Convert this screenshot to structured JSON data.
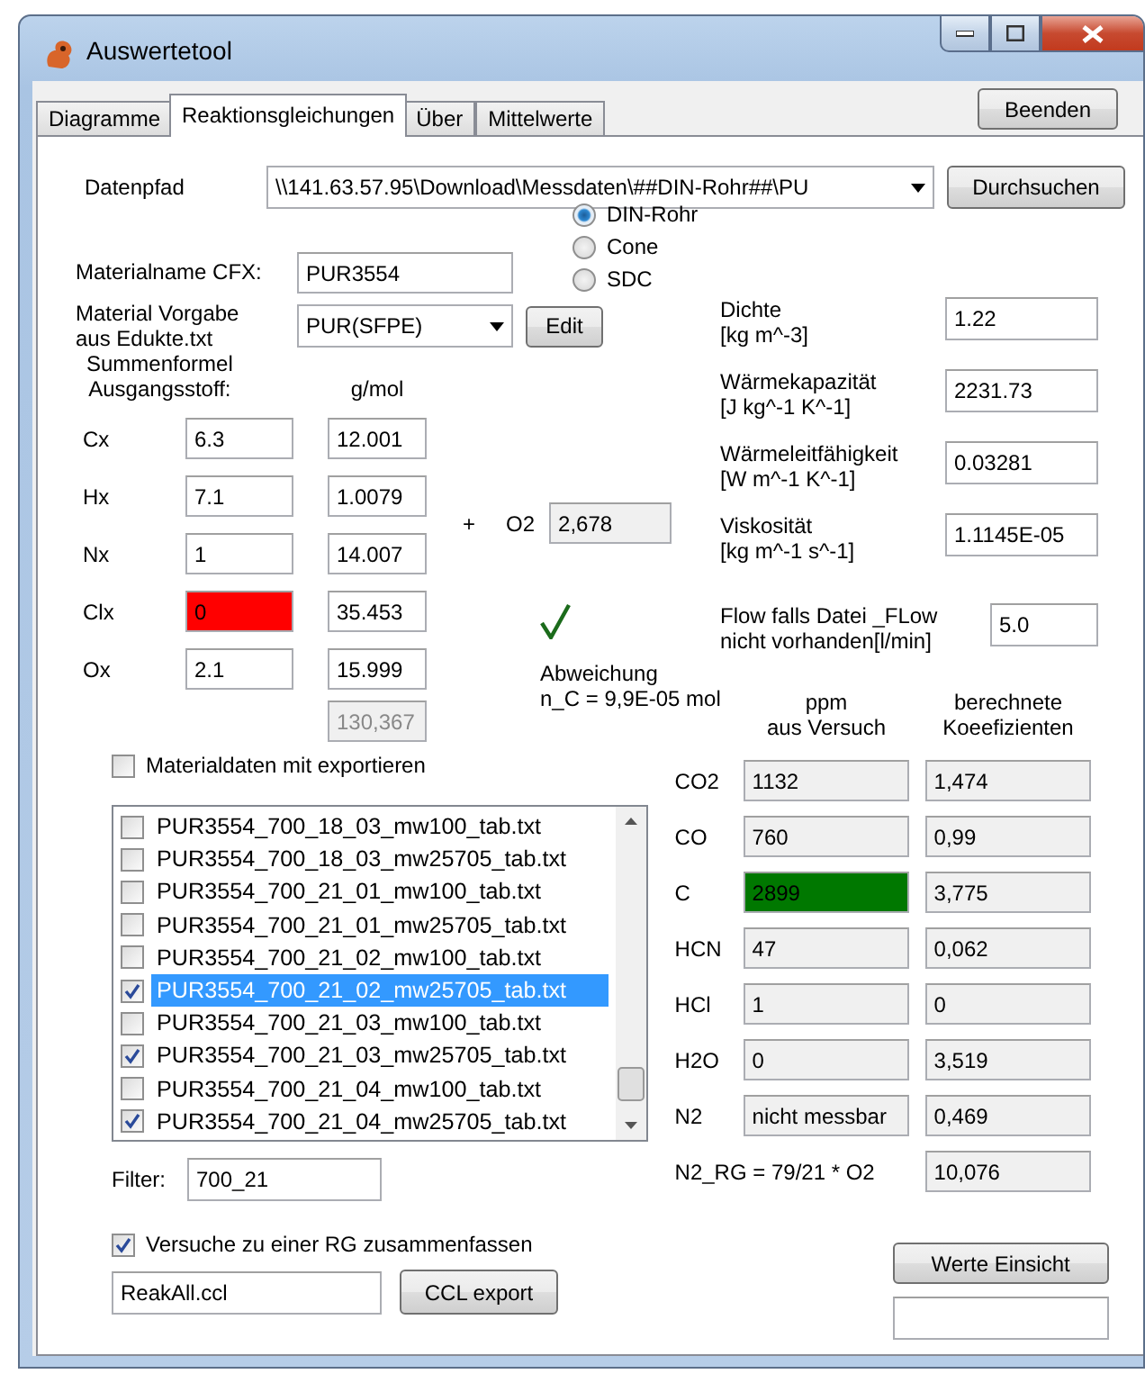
{
  "window": {
    "title": "Auswertetool"
  },
  "tabs": [
    {
      "label": "Diagramme",
      "selected": false
    },
    {
      "label": "Reaktionsgleichungen",
      "selected": true
    },
    {
      "label": "Über",
      "selected": false
    },
    {
      "label": "Mittelwerte",
      "selected": false
    }
  ],
  "quit_button": "Beenden",
  "data_path": {
    "label": "Datenpfad",
    "value": "\\\\141.63.57.95\\Download\\Messdaten\\##DIN-Rohr##\\PU",
    "button": "Durchsuchen"
  },
  "source_options": [
    {
      "label": "DIN-Rohr",
      "selected": true
    },
    {
      "label": "Cone",
      "selected": false
    },
    {
      "label": "SDC",
      "selected": false
    }
  ],
  "material_name": {
    "label": "Materialname CFX:",
    "value": "PUR3554"
  },
  "material_preset": {
    "label": "Material Vorgabe\naus Edukte.txt",
    "value": "PUR(SFPE)",
    "button": "Edit"
  },
  "formula": {
    "header": "Summenformel\nAusgangsstoff:",
    "molar_header": "g/mol",
    "total": "130,367",
    "elements": [
      {
        "symbol": "Cx",
        "count": "6.3",
        "molar_mass": "12.001",
        "error": false
      },
      {
        "symbol": "Hx",
        "count": "7.1",
        "molar_mass": "1.0079",
        "error": false
      },
      {
        "symbol": "Nx",
        "count": "1",
        "molar_mass": "14.007",
        "error": false
      },
      {
        "symbol": "Clx",
        "count": "0",
        "molar_mass": "35.453",
        "error": true
      },
      {
        "symbol": "Ox",
        "count": "2.1",
        "molar_mass": "15.999",
        "error": false
      }
    ]
  },
  "oxygen": {
    "plus": "+",
    "label": "O2",
    "value": "2,678"
  },
  "balance": {
    "ok": true,
    "text": "Abweichung\nn_C = 9,9E-05 mol"
  },
  "properties": [
    {
      "label": "Dichte\n[kg m^-3]",
      "value": "1.22"
    },
    {
      "label": "Wärmekapazität\n[J kg^-1 K^-1]",
      "value": "2231.73"
    },
    {
      "label": "Wärmeleitfähigkeit\n[W m^-1 K^-1]",
      "value": "0.03281"
    },
    {
      "label": "Viskosität\n[kg m^-1 s^-1]",
      "value": "1.1145E-05"
    }
  ],
  "flow": {
    "label": "Flow falls Datei _FLow\nnicht vorhanden[l/min]",
    "value": "5.0"
  },
  "export_material": {
    "label": "Materialdaten mit exportieren",
    "checked": false
  },
  "files": [
    {
      "name": "PUR3554_700_18_03_mw100_tab.txt",
      "checked": false,
      "selected": false
    },
    {
      "name": "PUR3554_700_18_03_mw25705_tab.txt",
      "checked": false,
      "selected": false
    },
    {
      "name": "PUR3554_700_21_01_mw100_tab.txt",
      "checked": false,
      "selected": false
    },
    {
      "name": "PUR3554_700_21_01_mw25705_tab.txt",
      "checked": false,
      "selected": false
    },
    {
      "name": "PUR3554_700_21_02_mw100_tab.txt",
      "checked": false,
      "selected": false
    },
    {
      "name": "PUR3554_700_21_02_mw25705_tab.txt",
      "checked": true,
      "selected": true
    },
    {
      "name": "PUR3554_700_21_03_mw100_tab.txt",
      "checked": false,
      "selected": false
    },
    {
      "name": "PUR3554_700_21_03_mw25705_tab.txt",
      "checked": true,
      "selected": false
    },
    {
      "name": "PUR3554_700_21_04_mw100_tab.txt",
      "checked": false,
      "selected": false
    },
    {
      "name": "PUR3554_700_21_04_mw25705_tab.txt",
      "checked": true,
      "selected": false
    }
  ],
  "filter": {
    "label": "Filter:",
    "value": "700_21"
  },
  "combine": {
    "label": "Versuche zu einer RG zusammenfassen",
    "checked": true
  },
  "ccl": {
    "value": "ReakAll.ccl",
    "button": "CCL export"
  },
  "gases": {
    "ppm_header": "ppm\naus Versuch",
    "coeff_header": "berechnete\nKoeefizienten",
    "rows": [
      {
        "name": "CO2",
        "ppm": "1132",
        "coeff": "1,474",
        "highlight": false
      },
      {
        "name": "CO",
        "ppm": "760",
        "coeff": "0,99",
        "highlight": false
      },
      {
        "name": "C",
        "ppm": "2899",
        "coeff": "3,775",
        "highlight": true
      },
      {
        "name": "HCN",
        "ppm": "47",
        "coeff": "0,062",
        "highlight": false
      },
      {
        "name": "HCl",
        "ppm": "1",
        "coeff": "0",
        "highlight": false
      },
      {
        "name": "H2O",
        "ppm": "0",
        "coeff": "3,519",
        "highlight": false
      },
      {
        "name": "N2",
        "ppm": "nicht messbar",
        "coeff": "0,469",
        "highlight": false
      }
    ],
    "n2_rg": {
      "label": "N2_RG = 79/21 * O2",
      "value": "10,076"
    }
  },
  "values_button": "Werte Einsicht"
}
